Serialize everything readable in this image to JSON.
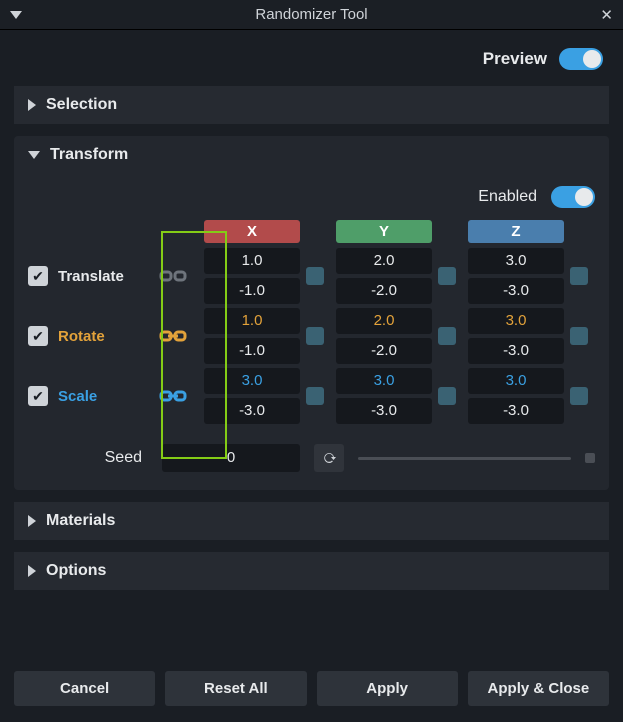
{
  "window": {
    "title": "Randomizer Tool"
  },
  "preview": {
    "label": "Preview",
    "on": true
  },
  "sections": {
    "selection": {
      "title": "Selection"
    },
    "transform": {
      "title": "Transform",
      "enabled_label": "Enabled",
      "enabled_on": true,
      "axes": {
        "x": "X",
        "y": "Y",
        "z": "Z"
      },
      "rows": {
        "translate": {
          "label": "Translate",
          "x_hi": "1.0",
          "x_lo": "-1.0",
          "y_hi": "2.0",
          "y_lo": "-2.0",
          "z_hi": "3.0",
          "z_lo": "-3.0"
        },
        "rotate": {
          "label": "Rotate",
          "x_hi": "1.0",
          "x_lo": "-1.0",
          "y_hi": "2.0",
          "y_lo": "-2.0",
          "z_hi": "3.0",
          "z_lo": "-3.0"
        },
        "scale": {
          "label": "Scale",
          "x_hi": "3.0",
          "x_lo": "-3.0",
          "y_hi": "3.0",
          "y_lo": "-3.0",
          "z_hi": "3.0",
          "z_lo": "-3.0"
        }
      },
      "seed": {
        "label": "Seed",
        "value": "0"
      }
    },
    "materials": {
      "title": "Materials"
    },
    "options": {
      "title": "Options"
    }
  },
  "footer": {
    "cancel": "Cancel",
    "reset_all": "Reset All",
    "apply": "Apply",
    "apply_close": "Apply & Close"
  },
  "colors": {
    "accent": "#3aa0e3",
    "warn": "#e3a23a",
    "highlight": "#84cc16"
  }
}
